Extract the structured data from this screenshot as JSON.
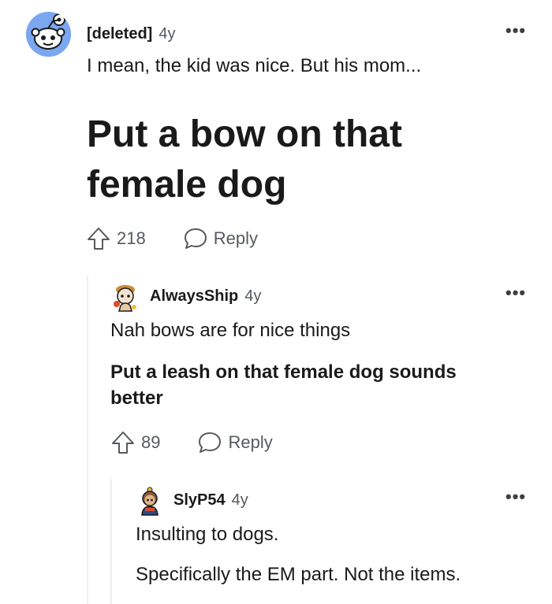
{
  "comments": [
    {
      "author": "[deleted]",
      "age": "4y",
      "text": "I mean, the kid was nice. But his mom...",
      "heading": "Put a bow on that female dog",
      "upvotes": "218",
      "reply_label": "Reply",
      "avatar_icon": "snoo-avatar-icon",
      "more_icon": "more-options-icon"
    },
    {
      "author": "AlwaysShip",
      "age": "4y",
      "text": "Nah bows are for nice things",
      "bold_text": "Put a leash on that female dog sounds better",
      "upvotes": "89",
      "reply_label": "Reply",
      "avatar_icon": "user-avatar-icon",
      "more_icon": "more-options-icon"
    },
    {
      "author": "SlyP54",
      "age": "4y",
      "text_line1": "Insulting to dogs.",
      "text_line2": "Specifically the EM part. Not the items.",
      "avatar_icon": "user-avatar-icon",
      "more_icon": "more-options-icon"
    }
  ],
  "colors": {
    "text": "#1a1a1b",
    "muted": "#555a5e",
    "thread_line": "#edeff1",
    "avatar_bg": "#7aa7f0"
  }
}
